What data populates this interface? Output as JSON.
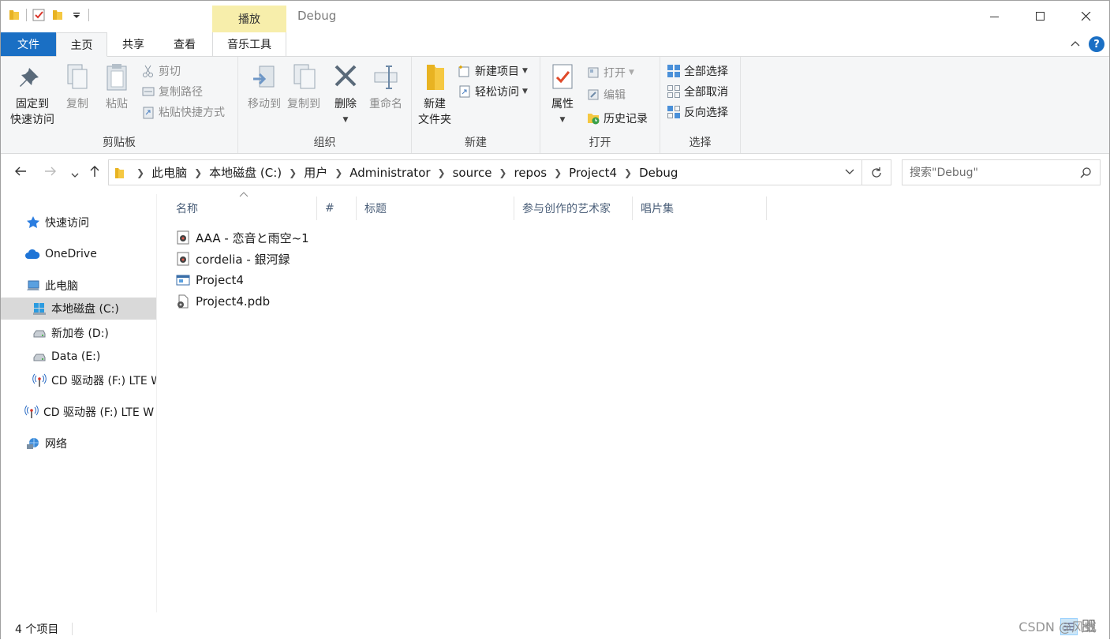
{
  "window": {
    "title": "Debug",
    "contextual_tab": "播放",
    "caption_buttons": {
      "minimize": "—",
      "maximize": "☐",
      "close": "✕"
    }
  },
  "ribbon_tabs": {
    "file": "文件",
    "home": "主页",
    "share": "共享",
    "view": "查看",
    "music_tools": "音乐工具",
    "help": "?"
  },
  "ribbon": {
    "clipboard": {
      "label": "剪贴板",
      "pin_line1": "固定到",
      "pin_line2": "快速访问",
      "copy": "复制",
      "paste": "粘贴",
      "cut": "剪切",
      "copy_path": "复制路径",
      "paste_shortcut": "粘贴快捷方式"
    },
    "organize": {
      "label": "组织",
      "move_to": "移动到",
      "copy_to": "复制到",
      "delete": "删除",
      "rename": "重命名"
    },
    "new": {
      "label": "新建",
      "new_folder_line1": "新建",
      "new_folder_line2": "文件夹",
      "new_item": "新建项目",
      "easy_access": "轻松访问"
    },
    "open": {
      "label": "打开",
      "properties": "属性",
      "open": "打开",
      "edit": "编辑",
      "history": "历史记录"
    },
    "select": {
      "label": "选择",
      "select_all": "全部选择",
      "select_none": "全部取消",
      "invert": "反向选择"
    }
  },
  "address": {
    "breadcrumbs": [
      "此电脑",
      "本地磁盘 (C:)",
      "用户",
      "Administrator",
      "source",
      "repos",
      "Project4",
      "Debug"
    ],
    "search_placeholder": "搜索\"Debug\""
  },
  "nav": {
    "quick_access": "快速访问",
    "onedrive": "OneDrive",
    "this_pc": "此电脑",
    "drive_c": "本地磁盘 (C:)",
    "drive_d": "新加卷 (D:)",
    "drive_e": "Data (E:)",
    "drive_f_sub": "CD 驱动器 (F:) LTE W",
    "drive_f": "CD 驱动器 (F:) LTE W",
    "network": "网络"
  },
  "columns": {
    "name": "名称",
    "number": "#",
    "title": "标题",
    "artists": "参与创作的艺术家",
    "album": "唱片集"
  },
  "files": [
    {
      "name": "AAA - 恋音と雨空~1",
      "icon": "audio-file-icon"
    },
    {
      "name": "cordelia - 銀河録",
      "icon": "audio-file-icon"
    },
    {
      "name": "Project4",
      "icon": "exe-file-icon"
    },
    {
      "name": "Project4.pdb",
      "icon": "pdb-file-icon"
    }
  ],
  "status": {
    "count": "4 个项目"
  },
  "watermark": "CSDN @风或",
  "colors": {
    "file_tab": "#1a6fc4",
    "context_tab": "#f7eeab",
    "selected_nav": "#d9d9d9",
    "header_text": "#4c607a"
  }
}
